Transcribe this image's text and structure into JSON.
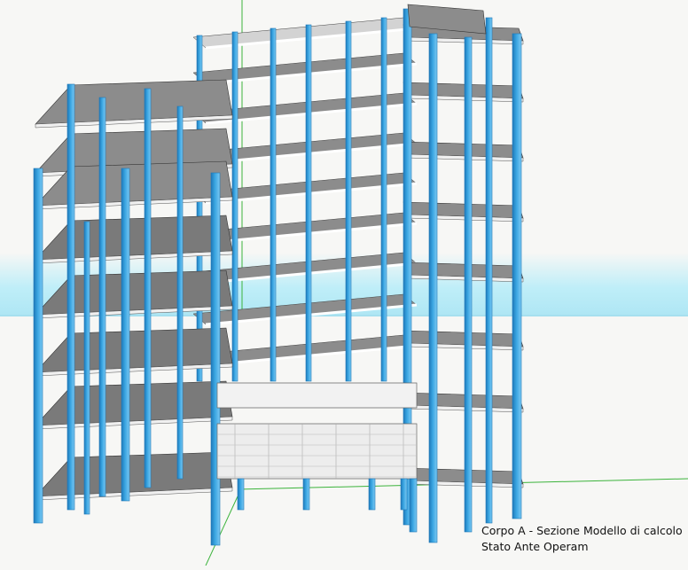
{
  "caption": {
    "line1": "Corpo A - Sezione Modello di calcolo",
    "line2": "Stato Ante Operam"
  },
  "colors": {
    "background": "#f7f7f5",
    "column": "#3aa6e2",
    "column_dark": "#1f78b8",
    "column_light": "#7cc8f2",
    "slab_top": "#8c8c8c",
    "slab_light": "#d3d3d3",
    "slab_edge": "#f0f0f0",
    "beam": "#ffffff",
    "axis_green": "#3bb33b",
    "horizon_cyan": "#b7eaf6"
  },
  "model": {
    "name": "Corpo A",
    "state": "Stato Ante Operam",
    "view": "3D structural calculation model"
  }
}
